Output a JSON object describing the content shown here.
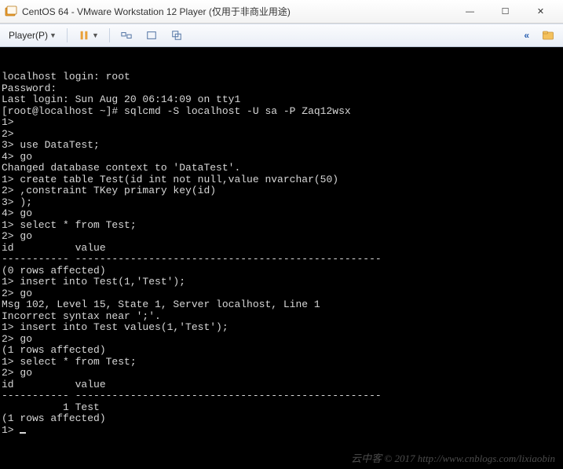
{
  "window": {
    "title": "CentOS 64 - VMware Workstation 12 Player (仅用于非商业用途)"
  },
  "toolbar": {
    "player_label": "Player(P)",
    "double_chevron": "«"
  },
  "terminal": {
    "lines": [
      "localhost login: root",
      "Password:",
      "Last login: Sun Aug 20 06:14:09 on tty1",
      "[root@localhost ~]# sqlcmd -S localhost -U sa -P Zaq12wsx",
      "1>",
      "2>",
      "3> use DataTest;",
      "4> go",
      "Changed database context to 'DataTest'.",
      "",
      "1> create table Test(id int not null,value nvarchar(50)",
      "2> ,constraint TKey primary key(id)",
      "3> );",
      "4> go",
      "1> select * from Test;",
      "2> go",
      "id          value",
      "----------- --------------------------------------------------",
      "",
      "(0 rows affected)",
      "1> insert into Test(1,'Test');",
      "2> go",
      "Msg 102, Level 15, State 1, Server localhost, Line 1",
      "Incorrect syntax near ';'.",
      "1> insert into Test values(1,'Test');",
      "2> go",
      "",
      "(1 rows affected)",
      "1> select * from Test;",
      "2> go",
      "id          value",
      "----------- --------------------------------------------------",
      "          1 Test",
      "",
      "(1 rows affected)",
      "1> "
    ]
  },
  "watermark": "云中客 © 2017 http://www.cnblogs.com/lixiaobin"
}
